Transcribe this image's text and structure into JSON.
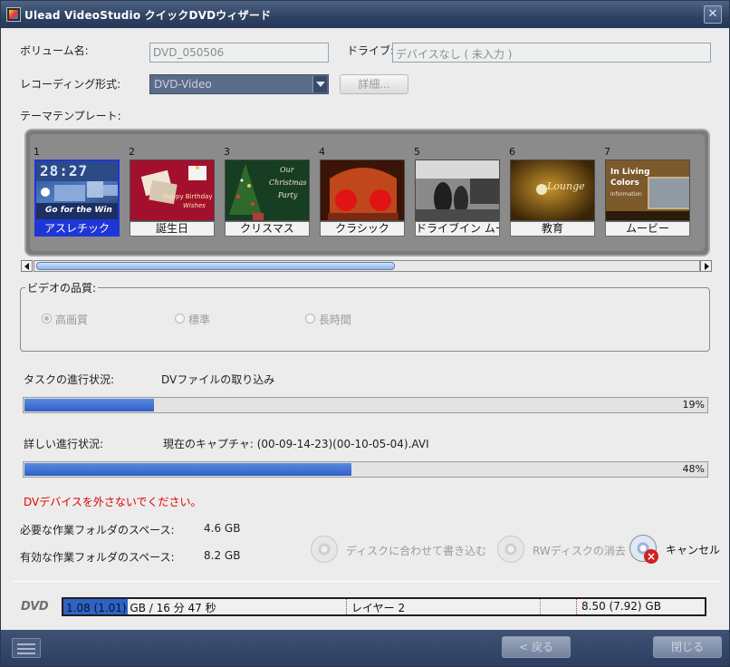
{
  "window": {
    "title": "Ulead VideoStudio クイックDVDウィザード",
    "close_glyph": "✕"
  },
  "volume": {
    "label": "ボリューム名:",
    "value": "DVD_050506"
  },
  "drive": {
    "label": "ドライブ:",
    "value": "デバイスなし ( 未入力 )"
  },
  "recording": {
    "label": "レコーディング形式:",
    "value": "DVD-Video",
    "details_button": "詳細..."
  },
  "theme": {
    "label": "テーマテンプレート:",
    "items": [
      {
        "num": "1",
        "name": "アスレチック",
        "selected": true
      },
      {
        "num": "2",
        "name": "誕生日"
      },
      {
        "num": "3",
        "name": "クリスマス"
      },
      {
        "num": "4",
        "name": "クラシック"
      },
      {
        "num": "5",
        "name": "ドライブイン ムー..."
      },
      {
        "num": "6",
        "name": "教育"
      },
      {
        "num": "7",
        "name": "ムービー"
      }
    ],
    "thumb_text": {
      "clock": "28:27",
      "athletic": "Go for the Win",
      "birthday_1": "Happy Birthday",
      "birthday_2": "Wishes",
      "xmas_1": "Our",
      "xmas_2": "Christmas",
      "xmas_3": "Party",
      "education": "Lounge",
      "movie_1": "In Living",
      "movie_2": "Colors",
      "movie_3": "Information"
    },
    "scroll_position": 0.0
  },
  "quality": {
    "label": "ビデオの品質:",
    "options": [
      {
        "label": "高画質",
        "selected": true
      },
      {
        "label": "標準",
        "selected": false
      },
      {
        "label": "長時間",
        "selected": false
      }
    ]
  },
  "task": {
    "label": "タスクの進行状況:",
    "value": "DVファイルの取り込み",
    "percent_text": "19%",
    "percent": 19
  },
  "detail": {
    "label": "詳しい進行状況:",
    "value": "現在のキャプチャ: (00-09-14-23)(00-10-05-04).AVI",
    "percent_text": "48%",
    "percent": 48
  },
  "warning": "DVデバイスを外さないでください。",
  "space": {
    "required_label": "必要な作業フォルダのスペース:",
    "required_value": "4.6 GB",
    "available_label": "有効な作業フォルダのスペース:",
    "available_value": "8.2 GB"
  },
  "actions": {
    "burn_fit": "ディスクに合わせて書き込む",
    "erase_rw": "RWディスクの消去",
    "cancel": "キャンセル"
  },
  "capacity": {
    "logo": "DVD",
    "used_text": "1.08 (1.01) GB / 16 分 47 秒",
    "layer_text": "レイヤー 2",
    "total_text": "8.50 (7.92) GB",
    "used_fraction": 0.1
  },
  "footer": {
    "back_button": "< 戻る",
    "close_button": "閉じる"
  },
  "colors": {
    "accent": "#2f5fc4",
    "warning": "#e00000",
    "selected_template": "#1f36d6"
  }
}
